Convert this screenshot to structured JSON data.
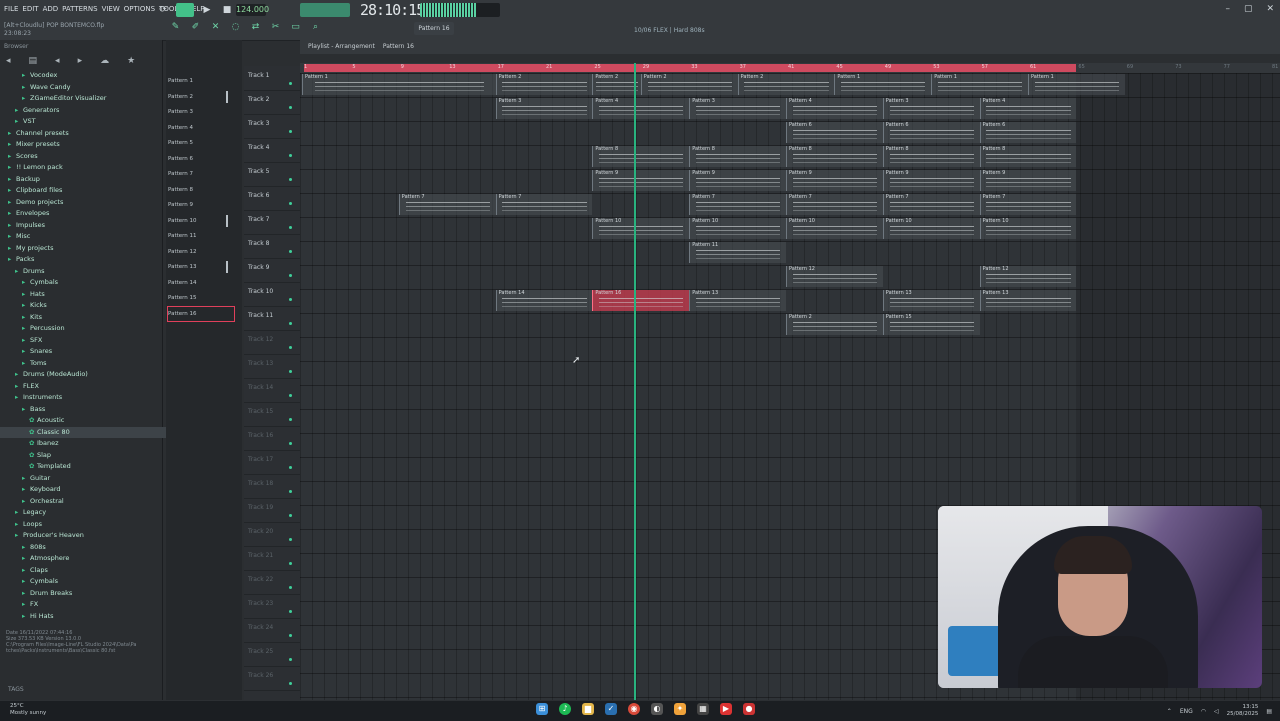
{
  "menu": [
    "FILE",
    "EDIT",
    "ADD",
    "PATTERNS",
    "VIEW",
    "OPTIONS",
    "TOOLS",
    "HELP"
  ],
  "song_info": {
    "title": "[Alt+Cloudlu] POP BONTEMCO.flp",
    "time": "23:08:23"
  },
  "tempo": "124.000",
  "time_display": "28:10:15",
  "pattern_selector": "Pattern 16",
  "hint_line": "10/06 FLEX | Hard 808s",
  "playlist_header": {
    "title": "Playlist - Arrangement",
    "pattern": "Pattern 16"
  },
  "browser": {
    "header": "Browser",
    "items": [
      {
        "label": "Vocodex",
        "indent": 2,
        "type": "folder"
      },
      {
        "label": "Wave Candy",
        "indent": 2,
        "type": "folder"
      },
      {
        "label": "ZGameEditor Visualizer",
        "indent": 2,
        "type": "folder"
      },
      {
        "label": "Generators",
        "indent": 1,
        "type": "folder"
      },
      {
        "label": "VST",
        "indent": 1,
        "type": "folder"
      },
      {
        "label": "Channel presets",
        "indent": 0,
        "type": "folder"
      },
      {
        "label": "Mixer presets",
        "indent": 0,
        "type": "folder"
      },
      {
        "label": "Scores",
        "indent": 0,
        "type": "folder"
      },
      {
        "label": "!! Lemon pack",
        "indent": 0,
        "type": "folder"
      },
      {
        "label": "Backup",
        "indent": 0,
        "type": "folder"
      },
      {
        "label": "Clipboard files",
        "indent": 0,
        "type": "folder"
      },
      {
        "label": "Demo projects",
        "indent": 0,
        "type": "folder"
      },
      {
        "label": "Envelopes",
        "indent": 0,
        "type": "folder"
      },
      {
        "label": "Impulses",
        "indent": 0,
        "type": "folder"
      },
      {
        "label": "Misc",
        "indent": 0,
        "type": "folder"
      },
      {
        "label": "My projects",
        "indent": 0,
        "type": "folder"
      },
      {
        "label": "Packs",
        "indent": 0,
        "type": "folder"
      },
      {
        "label": "Drums",
        "indent": 1,
        "type": "folder"
      },
      {
        "label": "Cymbals",
        "indent": 2,
        "type": "folder"
      },
      {
        "label": "Hats",
        "indent": 2,
        "type": "folder"
      },
      {
        "label": "Kicks",
        "indent": 2,
        "type": "folder"
      },
      {
        "label": "Kits",
        "indent": 2,
        "type": "folder"
      },
      {
        "label": "Percussion",
        "indent": 2,
        "type": "folder"
      },
      {
        "label": "SFX",
        "indent": 2,
        "type": "folder"
      },
      {
        "label": "Snares",
        "indent": 2,
        "type": "folder"
      },
      {
        "label": "Toms",
        "indent": 2,
        "type": "folder"
      },
      {
        "label": "Drums (ModeAudio)",
        "indent": 1,
        "type": "folder"
      },
      {
        "label": "FLEX",
        "indent": 1,
        "type": "folder"
      },
      {
        "label": "Instruments",
        "indent": 1,
        "type": "folder"
      },
      {
        "label": "Bass",
        "indent": 2,
        "type": "folder"
      },
      {
        "label": "Acoustic",
        "indent": 3,
        "type": "preset"
      },
      {
        "label": "Classic 80",
        "indent": 3,
        "type": "preset",
        "selected": true
      },
      {
        "label": "Ibanez",
        "indent": 3,
        "type": "preset"
      },
      {
        "label": "Slap",
        "indent": 3,
        "type": "preset"
      },
      {
        "label": "Templated",
        "indent": 3,
        "type": "preset"
      },
      {
        "label": "Guitar",
        "indent": 2,
        "type": "folder"
      },
      {
        "label": "Keyboard",
        "indent": 2,
        "type": "folder"
      },
      {
        "label": "Orchestral",
        "indent": 2,
        "type": "folder"
      },
      {
        "label": "Legacy",
        "indent": 1,
        "type": "folder"
      },
      {
        "label": "Loops",
        "indent": 1,
        "type": "folder"
      },
      {
        "label": "Producer's Heaven",
        "indent": 1,
        "type": "folder"
      },
      {
        "label": "808s",
        "indent": 2,
        "type": "folder"
      },
      {
        "label": "Atmosphere",
        "indent": 2,
        "type": "folder"
      },
      {
        "label": "Claps",
        "indent": 2,
        "type": "folder"
      },
      {
        "label": "Cymbals",
        "indent": 2,
        "type": "folder"
      },
      {
        "label": "Drum Breaks",
        "indent": 2,
        "type": "folder"
      },
      {
        "label": "FX",
        "indent": 2,
        "type": "folder"
      },
      {
        "label": "Hi Hats",
        "indent": 2,
        "type": "folder"
      }
    ],
    "footer": [
      "Date  16/11/2022 07:44:16",
      "Size  373.53 KB   Version 13.0.0",
      "C:\\Program Files\\Image-Line\\FL Studio 2024\\Data\\Pa",
      "tches\\Packs\\Instruments\\Bass\\Classic 80.fst"
    ],
    "tags_label": "TAGS"
  },
  "patterns": [
    "Pattern 1",
    "Pattern 2",
    "Pattern 3",
    "Pattern 4",
    "Pattern 5",
    "Pattern 6",
    "Pattern 7",
    "Pattern 8",
    "Pattern 9",
    "Pattern 10",
    "Pattern 11",
    "Pattern 12",
    "Pattern 13",
    "Pattern 14",
    "Pattern 15",
    "Pattern 16"
  ],
  "tracks": [
    "Track 1",
    "Track 2",
    "Track 3",
    "Track 4",
    "Track 5",
    "Track 6",
    "Track 7",
    "Track 8",
    "Track 9",
    "Track 10",
    "Track 11",
    "Track 12",
    "Track 13",
    "Track 14",
    "Track 15",
    "Track 16",
    "Track 17",
    "Track 18",
    "Track 19",
    "Track 20",
    "Track 21",
    "Track 22",
    "Track 23",
    "Track 24",
    "Track 25",
    "Track 26"
  ],
  "timeline_ticks": [
    "1",
    "5",
    "9",
    "13",
    "17",
    "21",
    "25",
    "29",
    "33",
    "37",
    "41",
    "45",
    "49",
    "53",
    "57",
    "61",
    "65",
    "69",
    "73",
    "77",
    "81"
  ],
  "clips": [
    {
      "track": 1,
      "start": 1,
      "len": 16,
      "label": "Pattern 1"
    },
    {
      "track": 1,
      "start": 17,
      "len": 8,
      "label": "Pattern 2"
    },
    {
      "track": 1,
      "start": 25,
      "len": 4,
      "label": "Pattern 2"
    },
    {
      "track": 1,
      "start": 29,
      "len": 8,
      "label": "Pattern 2"
    },
    {
      "track": 1,
      "start": 37,
      "len": 8,
      "label": "Pattern 2"
    },
    {
      "track": 1,
      "start": 45,
      "len": 8,
      "label": "Pattern 1"
    },
    {
      "track": 1,
      "start": 53,
      "len": 8,
      "label": "Pattern 1"
    },
    {
      "track": 1,
      "start": 61,
      "len": 8,
      "label": "Pattern 1"
    },
    {
      "track": 2,
      "start": 17,
      "len": 8,
      "label": "Pattern 3"
    },
    {
      "track": 2,
      "start": 25,
      "len": 8,
      "label": "Pattern 4"
    },
    {
      "track": 2,
      "start": 33,
      "len": 8,
      "label": "Pattern 3"
    },
    {
      "track": 2,
      "start": 41,
      "len": 8,
      "label": "Pattern 4"
    },
    {
      "track": 2,
      "start": 49,
      "len": 8,
      "label": "Pattern 3"
    },
    {
      "track": 2,
      "start": 57,
      "len": 8,
      "label": "Pattern 4"
    },
    {
      "track": 3,
      "start": 41,
      "len": 8,
      "label": "Pattern 6"
    },
    {
      "track": 3,
      "start": 49,
      "len": 8,
      "label": "Pattern 6"
    },
    {
      "track": 3,
      "start": 57,
      "len": 8,
      "label": "Pattern 6"
    },
    {
      "track": 4,
      "start": 25,
      "len": 8,
      "label": "Pattern 8"
    },
    {
      "track": 4,
      "start": 33,
      "len": 8,
      "label": "Pattern 8"
    },
    {
      "track": 4,
      "start": 41,
      "len": 8,
      "label": "Pattern 8"
    },
    {
      "track": 4,
      "start": 49,
      "len": 8,
      "label": "Pattern 8"
    },
    {
      "track": 4,
      "start": 57,
      "len": 8,
      "label": "Pattern 8"
    },
    {
      "track": 5,
      "start": 25,
      "len": 8,
      "label": "Pattern 9"
    },
    {
      "track": 5,
      "start": 33,
      "len": 8,
      "label": "Pattern 9"
    },
    {
      "track": 5,
      "start": 41,
      "len": 8,
      "label": "Pattern 9"
    },
    {
      "track": 5,
      "start": 49,
      "len": 8,
      "label": "Pattern 9"
    },
    {
      "track": 5,
      "start": 57,
      "len": 8,
      "label": "Pattern 9"
    },
    {
      "track": 6,
      "start": 9,
      "len": 8,
      "label": "Pattern 7"
    },
    {
      "track": 6,
      "start": 17,
      "len": 8,
      "label": "Pattern 7"
    },
    {
      "track": 6,
      "start": 33,
      "len": 8,
      "label": "Pattern 7"
    },
    {
      "track": 6,
      "start": 41,
      "len": 8,
      "label": "Pattern 7"
    },
    {
      "track": 6,
      "start": 49,
      "len": 8,
      "label": "Pattern 7"
    },
    {
      "track": 6,
      "start": 57,
      "len": 8,
      "label": "Pattern 7"
    },
    {
      "track": 7,
      "start": 25,
      "len": 8,
      "label": "Pattern 10"
    },
    {
      "track": 7,
      "start": 33,
      "len": 8,
      "label": "Pattern 10"
    },
    {
      "track": 7,
      "start": 41,
      "len": 8,
      "label": "Pattern 10"
    },
    {
      "track": 7,
      "start": 49,
      "len": 8,
      "label": "Pattern 10"
    },
    {
      "track": 7,
      "start": 57,
      "len": 8,
      "label": "Pattern 10"
    },
    {
      "track": 8,
      "start": 33,
      "len": 8,
      "label": "Pattern 11"
    },
    {
      "track": 9,
      "start": 41,
      "len": 8,
      "label": "Pattern 12"
    },
    {
      "track": 9,
      "start": 57,
      "len": 8,
      "label": "Pattern 12"
    },
    {
      "track": 10,
      "start": 17,
      "len": 8,
      "label": "Pattern 14"
    },
    {
      "track": 10,
      "start": 25,
      "len": 8,
      "label": "Pattern 16",
      "red": true
    },
    {
      "track": 10,
      "start": 33,
      "len": 8,
      "label": "Pattern 13"
    },
    {
      "track": 10,
      "start": 49,
      "len": 8,
      "label": "Pattern 13"
    },
    {
      "track": 10,
      "start": 57,
      "len": 8,
      "label": "Pattern 13"
    },
    {
      "track": 11,
      "start": 41,
      "len": 8,
      "label": "Pattern 2"
    },
    {
      "track": 11,
      "start": 49,
      "len": 8,
      "label": "Pattern 15"
    }
  ],
  "taskbar": {
    "weather_temp": "25°C",
    "weather_desc": "Mostly sunny",
    "lang": "ENG",
    "time": "13:15",
    "date": "25/08/2025"
  }
}
